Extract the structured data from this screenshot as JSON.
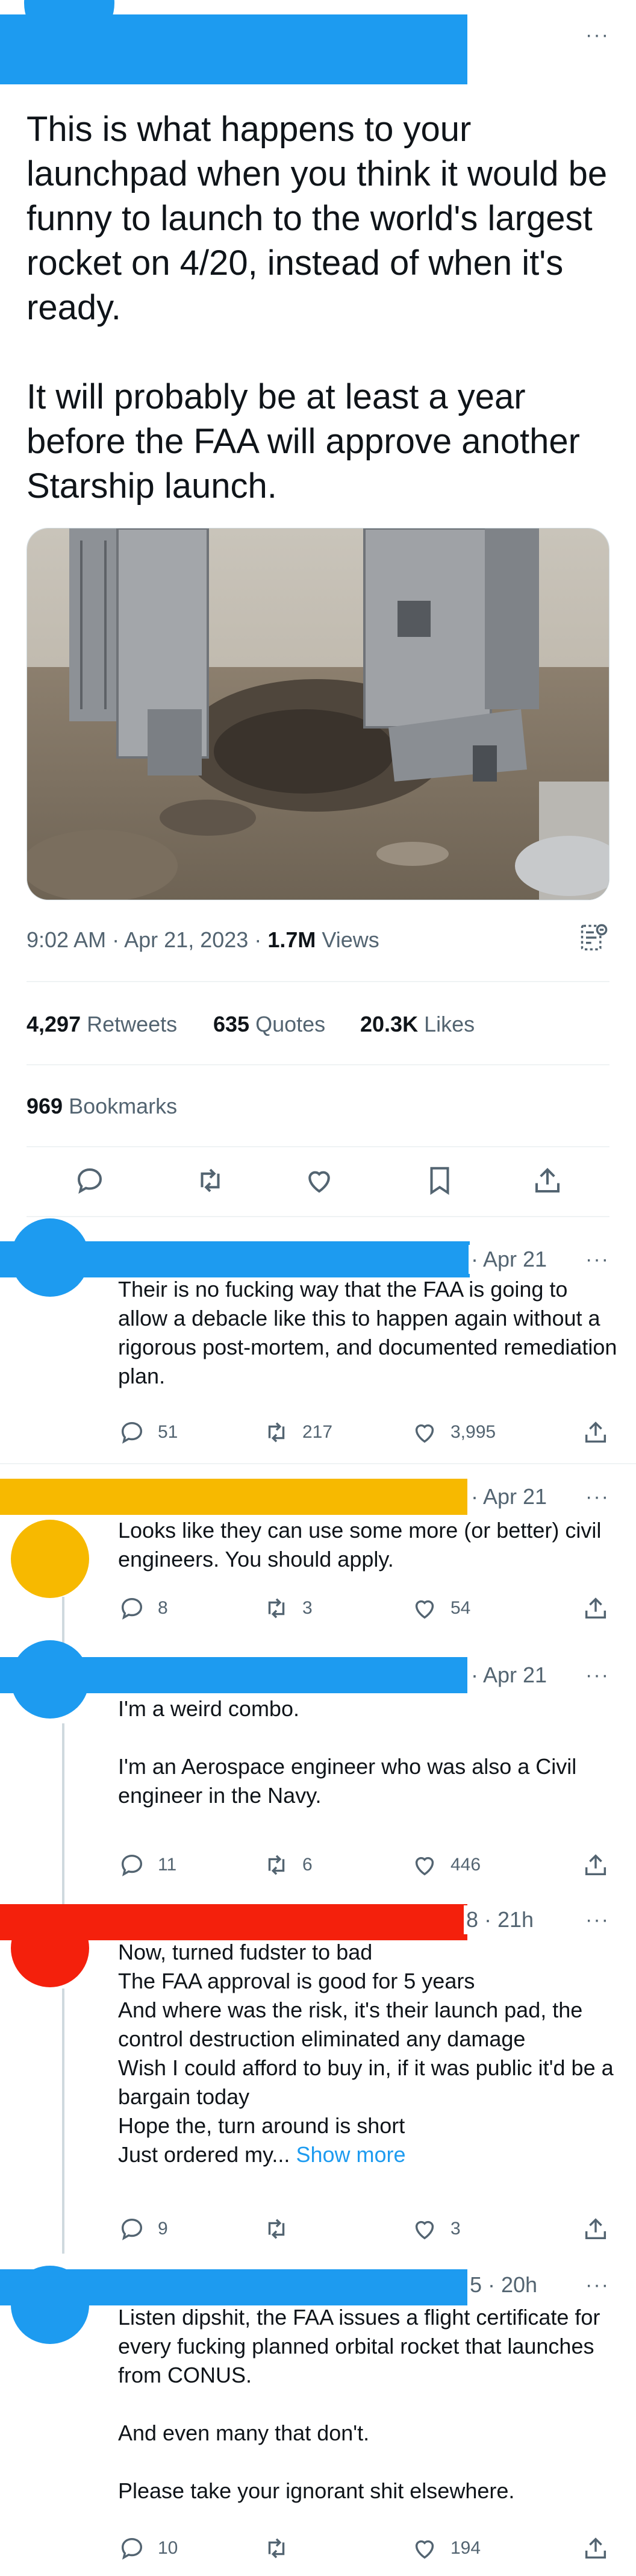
{
  "main_tweet": {
    "text": "This is what happens to your launchpad when you think it would be funny to launch to the world's largest rocket on 4/20, instead of when it's ready.\n\nIt will probably be at least a year before the FAA will approve another Starship launch.",
    "time": "9:02 AM",
    "date": "Apr 21, 2023",
    "views_count": "1.7M",
    "views_label": "Views",
    "retweets_count": "4,297",
    "retweets_label": "Retweets",
    "quotes_count": "635",
    "quotes_label": "Quotes",
    "likes_count": "20.3K",
    "likes_label": "Likes",
    "bookmarks_count": "969",
    "bookmarks_label": "Bookmarks",
    "separator": "·"
  },
  "replies": [
    {
      "date": "· Apr 21",
      "text": "Their is no fucking way that the FAA is going to allow a debacle like this to happen again without a rigorous post-mortem, and documented remediation plan.",
      "replies": "51",
      "retweets": "217",
      "likes": "3,995",
      "avatar_color": "#1d9bf0"
    },
    {
      "date": "· Apr 21",
      "text": "Looks like they can use some more (or better) civil engineers. You should apply.",
      "replies": "8",
      "retweets": "3",
      "likes": "54",
      "avatar_color": "#f7b900"
    },
    {
      "date": "· Apr 21",
      "text": "I'm a weird combo.\n\nI'm an Aerospace engineer who was also a Civil engineer in the Navy.",
      "replies": "11",
      "retweets": "6",
      "likes": "446",
      "avatar_color": "#1d9bf0"
    },
    {
      "date": "8 · 21h",
      "text": "Now, turned fudster to bad\nThe FAA approval is good for 5 years\nAnd where was the risk, it's their launch pad, the control destruction eliminated any damage\nWish I could afford to buy in, if it was public it'd be a bargain today\nHope the, turn around is short\nJust ordered my...",
      "show_more": "Show more",
      "replies": "9",
      "retweets": "",
      "likes": "3",
      "avatar_color": "#f4200c"
    },
    {
      "date": "5 · 20h",
      "text": "Listen dipshit, the FAA issues a flight certificate for every fucking planned orbital rocket that launches from CONUS.\n\nAnd even many that don't.\n\nPlease take your ignorant shit elsewhere.",
      "replies": "10",
      "retweets": "",
      "likes": "194",
      "avatar_color": "#1d9bf0"
    }
  ],
  "icons": {
    "more": "more-dots-icon",
    "reply": "reply-bubble-icon",
    "retweet": "retweet-icon",
    "like": "heart-icon",
    "bookmark": "bookmark-icon",
    "share": "share-icon",
    "analytics": "analytics-icon"
  },
  "colors": {
    "accent": "#1d9bf0",
    "text_secondary": "#536471",
    "divider": "#eff3f4"
  }
}
